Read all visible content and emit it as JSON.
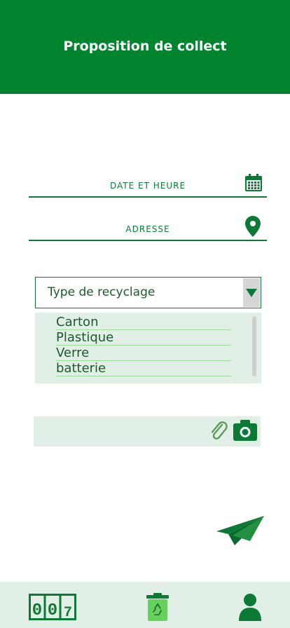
{
  "header": {
    "title": "Proposition de collect"
  },
  "form": {
    "date_label": "DATE ET HEURE",
    "address_label": "ADRESSE",
    "recycle_select": {
      "selected": "Type de recyclage",
      "options": [
        "Carton",
        "Plastique",
        "Verre",
        "batterie"
      ]
    }
  },
  "counter": {
    "digits": [
      "0",
      "0",
      "7"
    ]
  },
  "icons": {
    "date": "calendar-icon",
    "address": "location-pin-icon",
    "dropdown": "triangle-down-icon",
    "attach": "paperclip-icon",
    "camera": "camera-icon",
    "send": "paper-plane-icon",
    "nav_counter": "counter-icon",
    "nav_recycle": "recycle-bin-icon",
    "nav_profile": "user-icon"
  },
  "colors": {
    "primary": "#00852e",
    "light_panel": "#e2efe6",
    "text_green": "#0b7a35"
  }
}
